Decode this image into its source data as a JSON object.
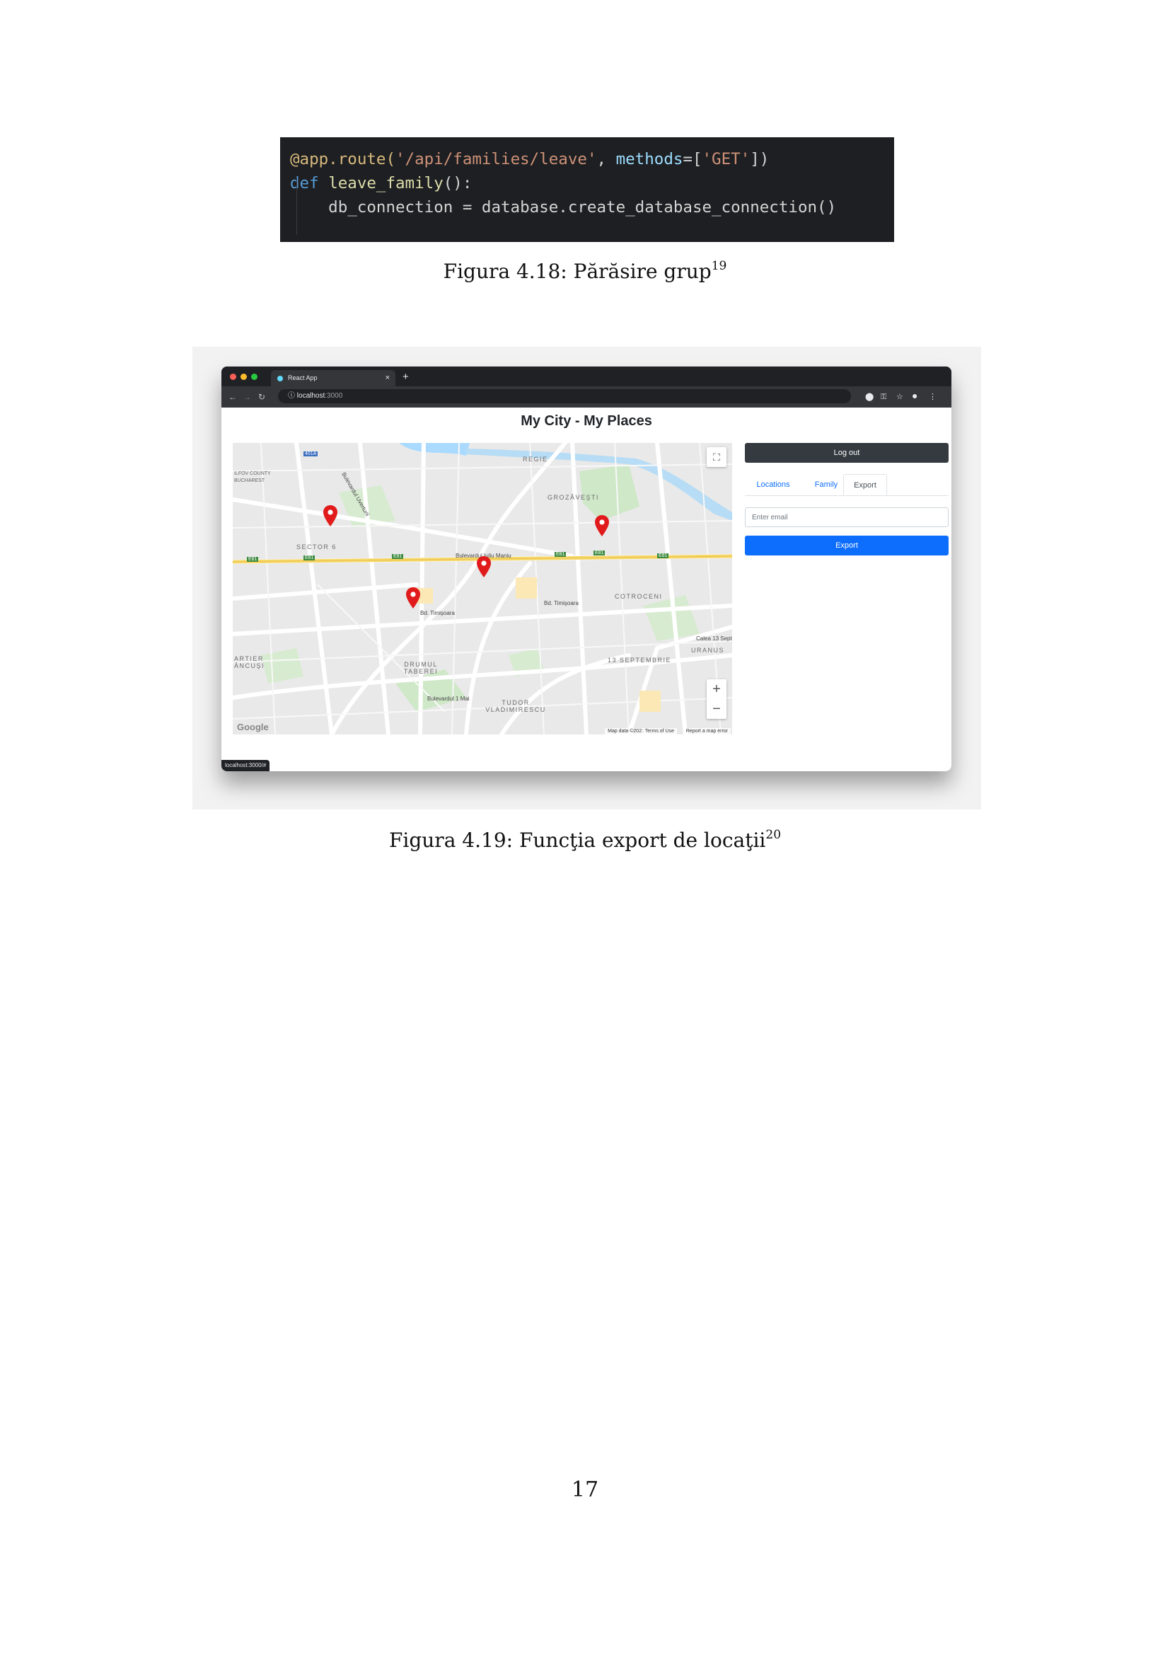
{
  "code": {
    "lines": [
      [
        {
          "t": "@app.route(",
          "c": "c-dec"
        },
        {
          "t": "'/api/families/leave'",
          "c": "c-str"
        },
        {
          "t": ", ",
          "c": "c-plain"
        },
        {
          "t": "methods",
          "c": "c-par"
        },
        {
          "t": "=[",
          "c": "c-plain"
        },
        {
          "t": "'GET'",
          "c": "c-str"
        },
        {
          "t": "])",
          "c": "c-plain"
        }
      ],
      [
        {
          "t": "def ",
          "c": "c-kw"
        },
        {
          "t": "leave_family",
          "c": "c-fn"
        },
        {
          "t": "():",
          "c": "c-plain"
        }
      ],
      [
        {
          "t": "    db_connection = database.create_database_connection()",
          "c": "c-plain"
        }
      ]
    ]
  },
  "figure1": {
    "caption": "Figura 4.18: Părăsire grup",
    "footnote": "19"
  },
  "figure2": {
    "caption": "Figura 4.19: Funcţia export de locaţii",
    "footnote": "20"
  },
  "browser": {
    "tab_title": "React App",
    "tab_close": "×",
    "new_tab": "+",
    "url_host": "localhost",
    "url_port": ":3000",
    "status_url": "localhost:3000/#"
  },
  "app": {
    "title": "My City - My Places",
    "logout_label": "Log out",
    "tabs": [
      "Locations",
      "Family",
      "Export"
    ],
    "active_tab": "Export",
    "email_placeholder": "Enter email",
    "export_label": "Export"
  },
  "map": {
    "district_labels": [
      "REGIE",
      "GROZĂVEŞTI",
      "SECTOR 6",
      "COTROCENI",
      "URANUS",
      "13 SEPTEMBRIE",
      "DRUMUL TABEREI",
      "TUDOR VLADIMIRESCU",
      "ARTIER ÂNCUŞI"
    ],
    "small_labels": [
      "ILFOV COUNTY",
      "BUCHAREST"
    ],
    "road_labels": [
      "Bulevardul Iuliu Maniu",
      "Bd. Timişoara",
      "Bd. Timişoara",
      "Bulevardul 1 Mai",
      "Calea 13 Septem",
      "Bulevardul Uverturii"
    ],
    "highway_shields": [
      "E81",
      "E81",
      "E81",
      "E81",
      "E81",
      "E81",
      "401A"
    ],
    "zoom_in": "+",
    "zoom_out": "−",
    "google": "Google",
    "footer": [
      "Map data ©2021",
      "Terms of Use",
      "Report a map error"
    ],
    "pins_count": 4
  },
  "page_number": "17"
}
